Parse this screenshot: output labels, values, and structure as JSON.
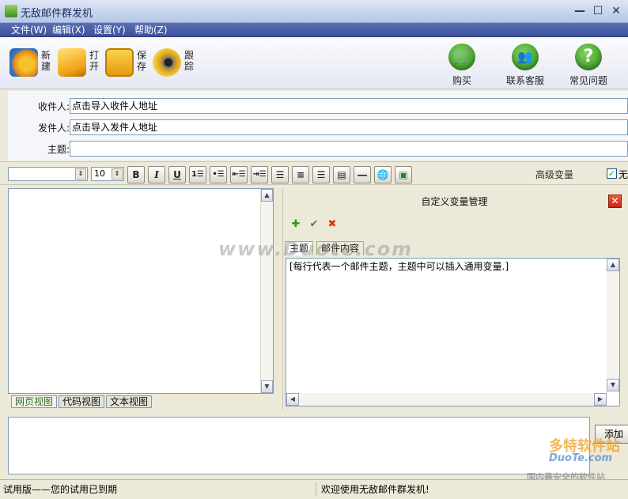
{
  "window": {
    "title": "无敌邮件群发机"
  },
  "menu": [
    {
      "label": "文件(W)"
    },
    {
      "label": "编辑(X)"
    },
    {
      "label": "设置(Y)"
    },
    {
      "label": "帮助(Z)"
    }
  ],
  "toolbar": {
    "left": [
      {
        "label": "新建",
        "icon": "new-document-icon"
      },
      {
        "label": "打开",
        "icon": "folder-open-icon"
      },
      {
        "label": "保存",
        "icon": "save-icon"
      },
      {
        "label": "跟踪",
        "icon": "tracking-icon"
      }
    ],
    "right": [
      {
        "label": "购买",
        "icon": "shopping-cart-icon",
        "glyph": "🛒",
        "color": "#3a9a2a"
      },
      {
        "label": "联系客服",
        "icon": "contact-support-icon",
        "glyph": "👥",
        "color": "#3a9a2a"
      },
      {
        "label": "常见问题",
        "icon": "help-question-icon",
        "glyph": "?",
        "color": "#3a9a2a"
      }
    ]
  },
  "fields": {
    "recipient_label": "收件人:",
    "recipient_value": "点击导入收件人地址",
    "sender_label": "发件人:",
    "sender_value": "点击导入发件人地址",
    "subject_label": "主题:",
    "subject_value": ""
  },
  "format": {
    "font_name": "",
    "font_size": "10",
    "advanced_vars_label": "高级变量",
    "checkbox_label": "无"
  },
  "editor": {
    "view_tabs": [
      "网页视图",
      "代码视图",
      "文本视图"
    ]
  },
  "var_panel": {
    "title": "自定义变量管理",
    "tabs": [
      "主题",
      "邮件内容"
    ],
    "text": "[每行代表一个邮件主题，主题中可以插入通用变量.]",
    "watermark": "www.Duote.com"
  },
  "bottom": {
    "add_label": "添加"
  },
  "status": {
    "left": "试用版——您的试用已到期",
    "right": "欢迎使用无敌邮件群发机!"
  },
  "watermark_logo": {
    "line1": "多特软件站",
    "line2": "DuoTe.com",
    "line3": "国内最安全的软件站"
  },
  "colors": {
    "menubar": "#3d509c",
    "accent_green": "#3a9a2a",
    "close_red": "#c8240e"
  }
}
